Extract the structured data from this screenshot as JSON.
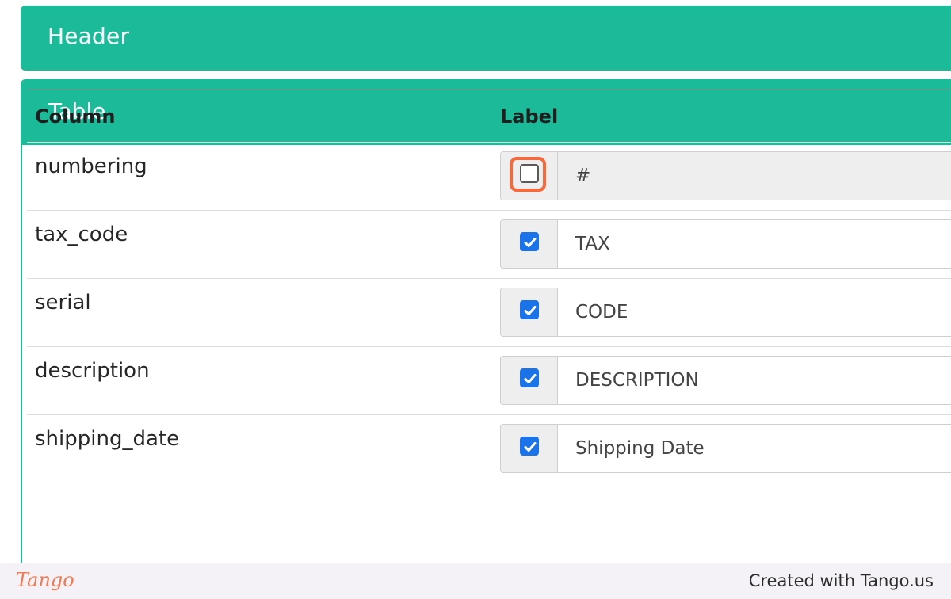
{
  "header_panel": {
    "title": "Header"
  },
  "table_panel": {
    "title": "Table",
    "columns": {
      "column": "Column",
      "label": "Label"
    },
    "rows": [
      {
        "name": "numbering",
        "checked": false,
        "label": "#",
        "disabled": true
      },
      {
        "name": "tax_code",
        "checked": true,
        "label": "TAX",
        "disabled": false
      },
      {
        "name": "serial",
        "checked": true,
        "label": "CODE",
        "disabled": false
      },
      {
        "name": "description",
        "checked": true,
        "label": "DESCRIPTION",
        "disabled": false
      },
      {
        "name": "shipping_date",
        "checked": true,
        "label": "Shipping Date",
        "disabled": false
      }
    ]
  },
  "footer": {
    "logo": "Tango",
    "credit": "Created with Tango.us"
  },
  "colors": {
    "accent": "#1bbb99",
    "checkbox": "#1a73e8",
    "highlight": "#f26a3d"
  }
}
